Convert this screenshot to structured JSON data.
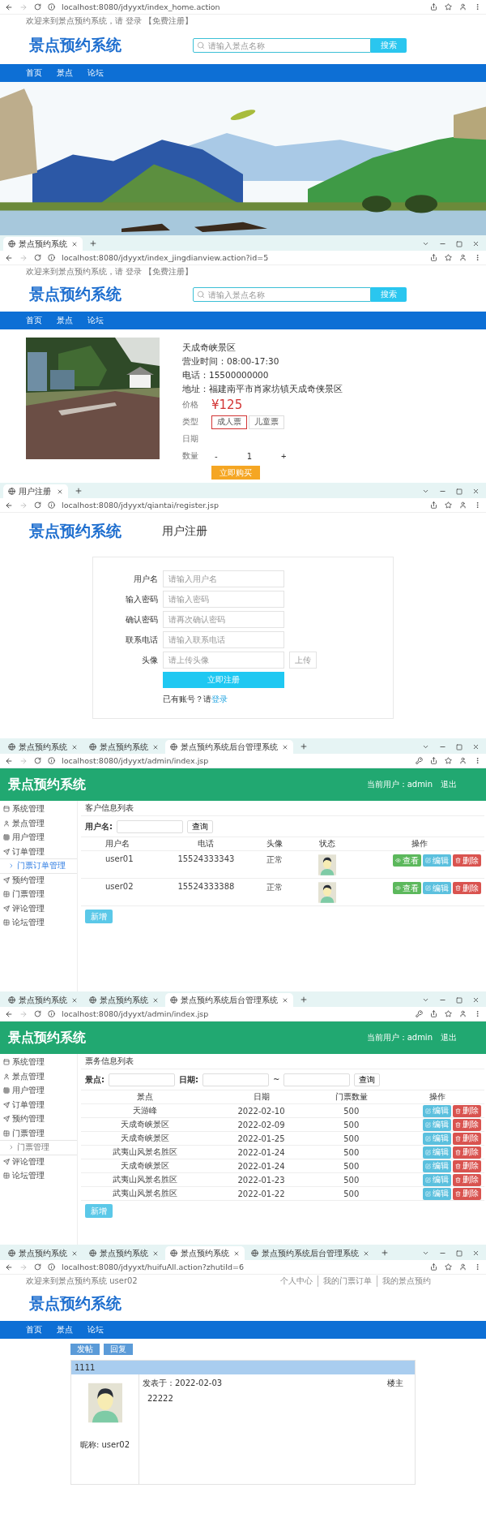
{
  "screens": [
    {
      "kind": "home",
      "url": "localhost:8080/jdyyxt/index_home.action",
      "welcome": "欢迎来到景点预约系统，请 登录 【免费注册】",
      "logo": "景点预约系统",
      "search": {
        "placeholder": "请输入景点名称",
        "button": "搜索"
      },
      "nav": [
        "首页",
        "景点",
        "论坛"
      ],
      "banner": {
        "kind": "picture"
      }
    },
    {
      "kind": "detail",
      "tabs": [
        {
          "label": "景点预约系统",
          "selected": true
        }
      ],
      "url": "localhost:8080/jdyyxt/index_jingdianview.action?id=5",
      "welcome": "欢迎来到景点预约系统，请 登录 【免费注册】",
      "logo": "景点预约系统",
      "search": {
        "placeholder": "请输入景点名称",
        "button": "搜索"
      },
      "nav": [
        "首页",
        "景点",
        "论坛"
      ],
      "spot": {
        "name": "天成奇峡景区",
        "lines": [
          "营业时间：08:00-17:30",
          "电话：15500000000",
          "地址：福建南平市肖家坊镇天成奇侠景区"
        ],
        "price_label": "价格",
        "price": "¥125",
        "type_label": "类型",
        "types": [
          {
            "label": "成人票",
            "selected": true
          },
          {
            "label": "儿童票",
            "selected": false
          }
        ],
        "date_label": "日期",
        "qty_label": "数量",
        "minus": "-",
        "qty": "1",
        "plus": "+",
        "buy": "立即购买"
      }
    },
    {
      "kind": "register",
      "tabs": [
        {
          "label": "用户注册",
          "selected": true
        }
      ],
      "url": "localhost:8080/jdyyxt/qiantai/register.jsp",
      "logo": "景点预约系统",
      "title": "用户注册",
      "fields": [
        {
          "label": "用户名",
          "placeholder": "请输入用户名"
        },
        {
          "label": "输入密码",
          "placeholder": "请输入密码"
        },
        {
          "label": "确认密码",
          "placeholder": "请再次确认密码"
        },
        {
          "label": "联系电话",
          "placeholder": "请输入联系电话"
        },
        {
          "label": "头像",
          "placeholder": "请上传头像",
          "button": "上传"
        }
      ],
      "submit": "立即注册",
      "login_prompt": "已有账号？请",
      "login_link": "登录"
    },
    {
      "kind": "admin",
      "tabs": [
        {
          "label": "景点预约系统",
          "selected": false
        },
        {
          "label": "景点预约系统",
          "selected": false
        },
        {
          "label": "景点预约系统后台管理系统",
          "selected": true
        }
      ],
      "url": "localhost:8080/jdyyxt/admin/index.jsp",
      "logo": "景点预约系统",
      "user": "当前用户：admin",
      "logout": "退出",
      "sidebar": [
        {
          "label": "系统管理"
        },
        {
          "label": "景点管理"
        },
        {
          "label": "用户管理"
        },
        {
          "label": "订单管理",
          "children": [
            {
              "label": "门票订单管理",
              "selected": true
            }
          ]
        },
        {
          "label": "预约管理"
        },
        {
          "label": "门票管理"
        },
        {
          "label": "评论管理"
        },
        {
          "label": "论坛管理"
        }
      ],
      "panel_title": "客户信息列表",
      "filters": [
        {
          "label": "用户名:"
        }
      ],
      "query": "查询",
      "table": {
        "kind": "users",
        "columns": [
          "用户名",
          "电话",
          "头像",
          "状态",
          "操作"
        ],
        "rows": [
          {
            "cells": [
              "user01",
              "15524333343",
              "正常"
            ],
            "actions": [
              {
                "kind": "view",
                "label": "查看"
              },
              {
                "kind": "edit",
                "label": "编辑"
              },
              {
                "kind": "delete",
                "label": "删除"
              }
            ]
          },
          {
            "cells": [
              "user02",
              "15524333388",
              "正常"
            ],
            "actions": [
              {
                "kind": "view",
                "label": "查看"
              },
              {
                "kind": "edit",
                "label": "编辑"
              },
              {
                "kind": "delete",
                "label": "删除"
              }
            ]
          }
        ]
      },
      "add": "新增"
    },
    {
      "kind": "admin",
      "tabs": [
        {
          "label": "景点预约系统",
          "selected": false
        },
        {
          "label": "景点预约系统",
          "selected": false
        },
        {
          "label": "景点预约系统后台管理系统",
          "selected": true
        }
      ],
      "url": "localhost:8080/jdyyxt/admin/index.jsp",
      "logo": "景点预约系统",
      "user": "当前用户：admin",
      "logout": "退出",
      "sidebar": [
        {
          "label": "系统管理"
        },
        {
          "label": "景点管理"
        },
        {
          "label": "用户管理"
        },
        {
          "label": "订单管理"
        },
        {
          "label": "预约管理"
        },
        {
          "label": "门票管理",
          "children": [
            {
              "label": "门票管理",
              "selected": false
            }
          ]
        },
        {
          "label": "评论管理"
        },
        {
          "label": "论坛管理"
        }
      ],
      "panel_title": "票务信息列表",
      "filters": [
        {
          "label": "景点:"
        },
        {
          "label": "日期:",
          "range": "~"
        }
      ],
      "query": "查询",
      "table": {
        "kind": "tickets",
        "columns": [
          "景点",
          "日期",
          "门票数量",
          "操作"
        ],
        "rows": [
          {
            "cells": [
              "天游峰",
              "2022-02-10",
              "500"
            ],
            "actions": [
              {
                "kind": "edit",
                "label": "编辑"
              },
              {
                "kind": "delete",
                "label": "删除"
              }
            ]
          },
          {
            "cells": [
              "天成奇峡景区",
              "2022-02-09",
              "500"
            ],
            "actions": [
              {
                "kind": "edit",
                "label": "编辑"
              },
              {
                "kind": "delete",
                "label": "删除"
              }
            ]
          },
          {
            "cells": [
              "天成奇峡景区",
              "2022-01-25",
              "500"
            ],
            "actions": [
              {
                "kind": "edit",
                "label": "编辑"
              },
              {
                "kind": "delete",
                "label": "删除"
              }
            ]
          },
          {
            "cells": [
              "武夷山风景名胜区",
              "2022-01-24",
              "500"
            ],
            "actions": [
              {
                "kind": "edit",
                "label": "编辑"
              },
              {
                "kind": "delete",
                "label": "删除"
              }
            ]
          },
          {
            "cells": [
              "天成奇峡景区",
              "2022-01-24",
              "500"
            ],
            "actions": [
              {
                "kind": "edit",
                "label": "编辑"
              },
              {
                "kind": "delete",
                "label": "删除"
              }
            ]
          },
          {
            "cells": [
              "武夷山风景名胜区",
              "2022-01-23",
              "500"
            ],
            "actions": [
              {
                "kind": "edit",
                "label": "编辑"
              },
              {
                "kind": "delete",
                "label": "删除"
              }
            ]
          },
          {
            "cells": [
              "武夷山风景名胜区",
              "2022-01-22",
              "500"
            ],
            "actions": [
              {
                "kind": "edit",
                "label": "编辑"
              },
              {
                "kind": "delete",
                "label": "删除"
              }
            ]
          }
        ]
      },
      "add": "新增"
    },
    {
      "kind": "forum",
      "tabs": [
        {
          "label": "景点预约系统",
          "selected": false
        },
        {
          "label": "景点预约系统",
          "selected": false
        },
        {
          "label": "景点预约系统",
          "selected": true
        },
        {
          "label": "景点预约系统后台管理系统",
          "selected": false
        }
      ],
      "url": "localhost:8080/jdyyxt/huifuAll.action?zhutiId=6",
      "welcome": "欢迎来到景点预约系统 user02",
      "top_links": [
        "个人中心",
        "我的门票订单",
        "我的景点预约"
      ],
      "logo": "景点预约系统",
      "nav": [
        "首页",
        "景点",
        "论坛"
      ],
      "buttons": [
        "发帖",
        "回复"
      ],
      "thread_title": "1111",
      "post": {
        "author": "昵称: user02",
        "posted": "发表于：2022-02-03",
        "floor": "楼主",
        "content": "22222"
      }
    }
  ]
}
